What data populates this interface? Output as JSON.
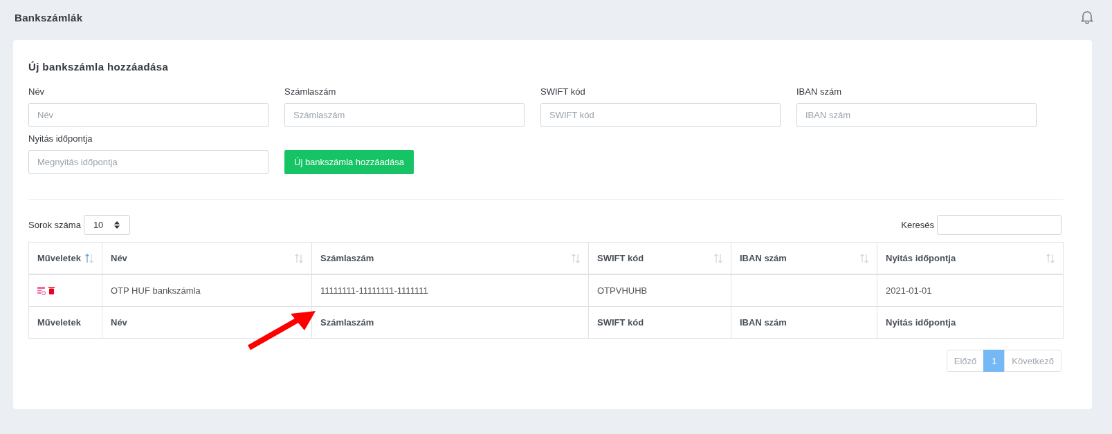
{
  "header": {
    "title": "Bankszámlák"
  },
  "form": {
    "title": "Új bankszámla hozzáadása",
    "fields": [
      {
        "label": "Név",
        "placeholder": "Név"
      },
      {
        "label": "Számlaszám",
        "placeholder": "Számlaszám"
      },
      {
        "label": "SWIFT kód",
        "placeholder": "SWIFT kód"
      },
      {
        "label": "IBAN szám",
        "placeholder": "IBAN szám"
      },
      {
        "label": "Nyitás időpontja",
        "placeholder": "Megnyitás időpontja"
      }
    ],
    "submit": "Új bankszámla hozzáadása"
  },
  "table_controls": {
    "rows_label": "Sorok száma",
    "rows_value": "10",
    "search_label": "Keresés"
  },
  "table": {
    "columns": [
      {
        "label": "Műveletek",
        "sorted": true
      },
      {
        "label": "Név",
        "sorted": false
      },
      {
        "label": "Számlaszám",
        "sorted": false
      },
      {
        "label": "SWIFT kód",
        "sorted": false
      },
      {
        "label": "IBAN szám",
        "sorted": false
      },
      {
        "label": "Nyitás időpontja",
        "sorted": false
      }
    ],
    "rows": [
      {
        "name": "OTP HUF bankszámla",
        "account": "11111111-11111111-1111111",
        "swift": "OTPVHUHB",
        "iban": "",
        "opened": "2021-01-01"
      }
    ],
    "footer": [
      "Műveletek",
      "Név",
      "Számlaszám",
      "SWIFT kód",
      "IBAN szám",
      "Nyitás időpontja"
    ]
  },
  "pagination": [
    {
      "label": "Előző",
      "kind": "prev",
      "selected": false,
      "disabled": true
    },
    {
      "label": "1",
      "kind": "page",
      "selected": true,
      "disabled": false
    },
    {
      "label": "Következő",
      "kind": "next",
      "selected": false,
      "disabled": true
    }
  ]
}
